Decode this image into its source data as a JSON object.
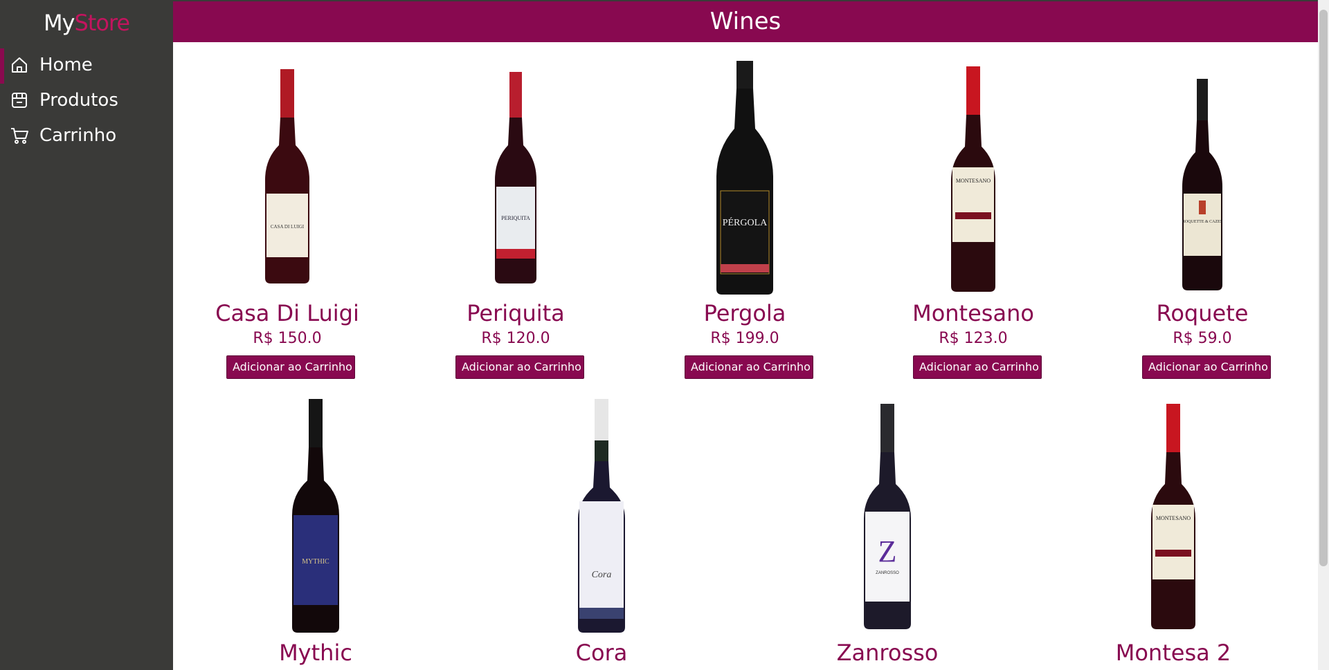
{
  "app": {
    "logo_part1": "My",
    "logo_part2": "Store",
    "accent_color": "#c3145e",
    "brand_color": "#880950"
  },
  "sidebar": {
    "items": [
      {
        "label": "Home",
        "icon": "home-icon",
        "active": true
      },
      {
        "label": "Produtos",
        "icon": "store-icon",
        "active": false
      },
      {
        "label": "Carrinho",
        "icon": "cart-icon",
        "active": false
      }
    ]
  },
  "header": {
    "title": "Wines"
  },
  "products": [
    {
      "name": "Casa Di Luigi",
      "price": "R$ 150.0",
      "button": "Adicionar ao Carrinho"
    },
    {
      "name": "Periquita",
      "price": "R$ 120.0",
      "button": "Adicionar ao Carrinho"
    },
    {
      "name": "Pergola",
      "price": "R$ 199.0",
      "button": "Adicionar ao Carrinho"
    },
    {
      "name": "Montesano",
      "price": "R$ 123.0",
      "button": "Adicionar ao Carrinho"
    },
    {
      "name": "Roquete",
      "price": "R$ 59.0",
      "button": "Adicionar ao Carrinho"
    },
    {
      "name": "Mythic"
    },
    {
      "name": "Cora"
    },
    {
      "name": "Zanrosso"
    },
    {
      "name": "Montesa 2"
    }
  ]
}
